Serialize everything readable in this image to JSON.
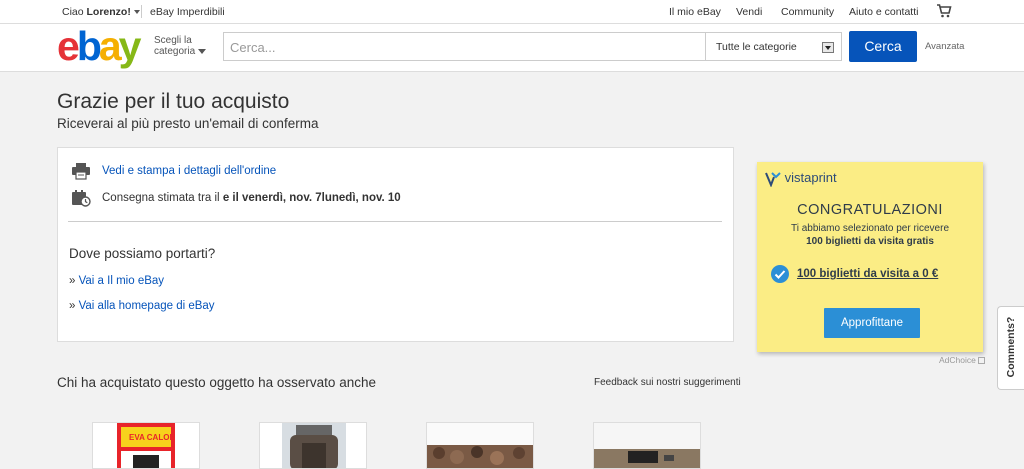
{
  "top_nav": {
    "greeting_prefix": "Ciao ",
    "user_name": "Lorenzo!",
    "deals": "eBay Imperdibili",
    "my_ebay": "Il mio eBay",
    "sell": "Vendi",
    "community": "Community",
    "help": "Aiuto e contatti",
    "cart_icon": "cart-icon"
  },
  "header": {
    "logo": {
      "e": "e",
      "b": "b",
      "a": "a",
      "y": "y"
    },
    "shop_by_category_line1": "Scegli la",
    "shop_by_category_line2": "categoria",
    "search_placeholder": "Cerca...",
    "category_selected": "Tutte le categorie",
    "search_button": "Cerca",
    "advanced": "Avanzata"
  },
  "page": {
    "title": "Grazie per il tuo acquisto",
    "subtitle": "Riceverai al più presto un'email di conferma"
  },
  "order_card": {
    "print_link": "Vedi e stampa i dettagli dell'ordine",
    "delivery_prefix": "Consegna stimata tra il ",
    "delivery_dates": "e il venerdì, nov. 7lunedì, nov. 10",
    "where_title": "Dove possiamo portarti?",
    "links": [
      {
        "bullet": "» ",
        "label": "Vai a Il mio eBay"
      },
      {
        "bullet": "» ",
        "label": "Vai alla homepage di eBay"
      }
    ]
  },
  "ad": {
    "brand": "vistaprint",
    "headline": "CONGRATULAZIONI",
    "line1": "Ti abbiamo selezionato per ricevere",
    "line2": "100 biglietti da visita gratis",
    "offer": "100 biglietti da visita a 0 €",
    "cta": "Approfittane",
    "adchoice": "AdChoice"
  },
  "comments_tab": "Comments?",
  "suggestions": {
    "title": "Chi ha acquistato questo oggetto ha osservato anche",
    "feedback": "Feedback sui nostri suggerimenti",
    "thumb_label": "EVA CALOR"
  },
  "colors": {
    "link": "#0654ba",
    "search_button": "#0654ba",
    "ad_bg": "#fbed85",
    "cta": "#2b8fd6"
  }
}
